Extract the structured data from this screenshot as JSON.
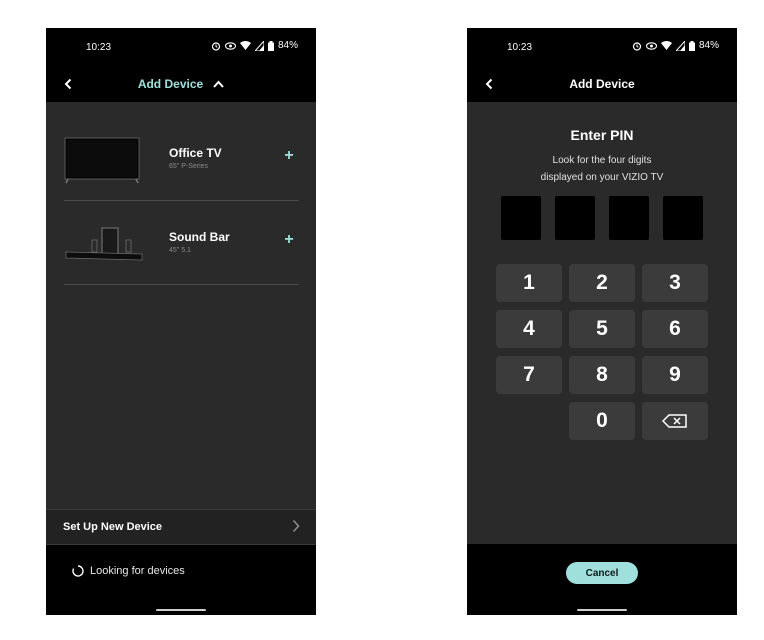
{
  "colors": {
    "accent": "#9fe0dc",
    "screen_bg": "#2a2a2a",
    "bar_bg": "#000000"
  },
  "left_screen": {
    "status_bar": {
      "time": "10:23",
      "battery": "84%",
      "icons": [
        "alarm-icon",
        "eye-icon",
        "wifi-icon",
        "signal-icon",
        "battery-icon"
      ]
    },
    "app_bar": {
      "title": "Add Device",
      "back_icon": "back-chevron-icon",
      "toggle_icon": "chevron-up-icon"
    },
    "devices": [
      {
        "name": "Office TV",
        "subtitle": "65\" P-Series",
        "image": "tv-icon",
        "action_icon": "plus-icon"
      },
      {
        "name": "Sound Bar",
        "subtitle": "45\" 5.1",
        "image": "soundbar-icon",
        "action_icon": "plus-icon"
      }
    ],
    "setup_row": {
      "label": "Set Up New Device",
      "icon": "chevron-right-icon"
    },
    "scan_status": {
      "label": "Looking for devices",
      "icon": "spinner-icon"
    }
  },
  "right_screen": {
    "status_bar": {
      "time": "10:23",
      "battery": "84%",
      "icons": [
        "alarm-icon",
        "eye-icon",
        "wifi-icon",
        "signal-icon",
        "battery-icon"
      ]
    },
    "app_bar": {
      "title": "Add Device",
      "back_icon": "back-chevron-icon"
    },
    "pin": {
      "title": "Enter PIN",
      "hint_line1": "Look for the four digits",
      "hint_line2": "displayed on your VIZIO TV",
      "digit_count": 4
    },
    "keypad": {
      "keys": [
        "1",
        "2",
        "3",
        "4",
        "5",
        "6",
        "7",
        "8",
        "9",
        "0"
      ],
      "backspace_icon": "backspace-icon"
    },
    "cancel_label": "Cancel"
  }
}
